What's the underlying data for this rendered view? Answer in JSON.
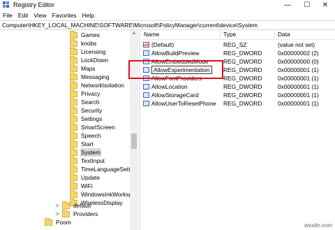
{
  "window": {
    "title": "Registry Editor",
    "min_glyph": "—",
    "max_glyph": "☐",
    "close_glyph": "✕"
  },
  "menu": [
    "File",
    "Edit",
    "View",
    "Favorites",
    "Help"
  ],
  "address": "Computer\\HKEY_LOCAL_MACHINE\\SOFTWARE\\Microsoft\\PolicyManager\\current\\device\\System",
  "tree": {
    "items": [
      {
        "label": "Games"
      },
      {
        "label": "knobs"
      },
      {
        "label": "Licensing"
      },
      {
        "label": "LockDown"
      },
      {
        "label": "Maps"
      },
      {
        "label": "Messaging"
      },
      {
        "label": "NetworkIsolation"
      },
      {
        "label": "Privacy"
      },
      {
        "label": "Search"
      },
      {
        "label": "Security"
      },
      {
        "label": "Settings"
      },
      {
        "label": "SmartScreen"
      },
      {
        "label": "Speech"
      },
      {
        "label": "Start"
      },
      {
        "label": "System",
        "selected": true
      },
      {
        "label": "TextInput"
      },
      {
        "label": "TimeLanguageSettings"
      },
      {
        "label": "Update"
      },
      {
        "label": "WiFi"
      },
      {
        "label": "WindowsInkWorkspace"
      },
      {
        "label": "WirelessDisplay"
      }
    ],
    "lower_items": [
      {
        "label": "default"
      },
      {
        "label": "Providers"
      },
      {
        "label": "Poom"
      }
    ],
    "expander_glyph": ">"
  },
  "list": {
    "headers": {
      "name": "Name",
      "type": "Type",
      "data": "Data"
    },
    "rows": [
      {
        "name": "(Default)",
        "type": "REG_SZ",
        "data": "(value not set)",
        "icon": "string-value-icon"
      },
      {
        "name": "AllowBuildPreview",
        "type": "REG_DWORD",
        "data": "0x00000002 (2)",
        "icon": "dword-value-icon"
      },
      {
        "name": "AllowEmbeddedMode",
        "type": "REG_DWORD",
        "data": "0x00000000 (0)",
        "icon": "dword-value-icon"
      },
      {
        "name": "AllowExperimentation",
        "type": "REG_DWORD",
        "data": "0x00000001 (1)",
        "icon": "dword-value-icon",
        "renaming": true
      },
      {
        "name": "AllowFontProviders",
        "type": "REG_DWORD",
        "data": "0x00000001 (1)",
        "icon": "dword-value-icon"
      },
      {
        "name": "AllowLocation",
        "type": "REG_DWORD",
        "data": "0x00000001 (1)",
        "icon": "dword-value-icon"
      },
      {
        "name": "AllowStorageCard",
        "type": "REG_DWORD",
        "data": "0x00000001 (1)",
        "icon": "dword-value-icon"
      },
      {
        "name": "AllowUserToResetPhone",
        "type": "REG_DWORD",
        "data": "0x00000001 (1)",
        "icon": "dword-value-icon"
      }
    ]
  },
  "watermark": "wsxdn.com",
  "colors": {
    "highlight": "#e0101e",
    "folder": "#f4d66d",
    "selection": "#d9d9d9"
  }
}
